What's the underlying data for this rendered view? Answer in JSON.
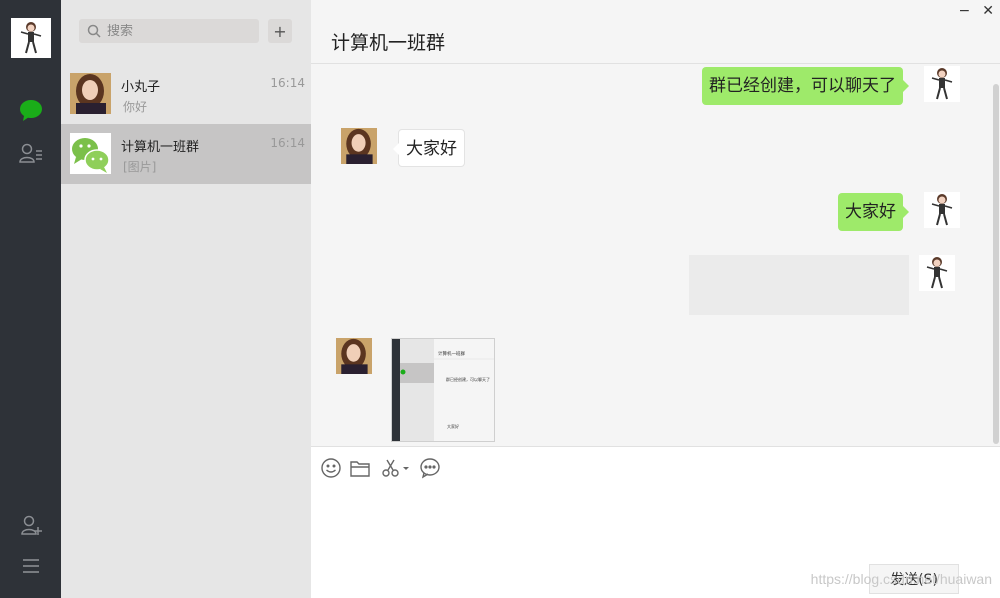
{
  "sidebar": {
    "icons": [
      "user-avatar",
      "chat-icon",
      "contacts-icon",
      "add-contact-icon",
      "menu-icon"
    ],
    "accent": "#1aad19"
  },
  "search": {
    "placeholder": "搜索",
    "add_label": "+"
  },
  "conversations": [
    {
      "name": "小丸子",
      "time": "16:14",
      "preview": "你好"
    },
    {
      "name": "计算机一班群",
      "time": "16:14",
      "preview": "[图片]"
    }
  ],
  "window": {
    "minimize": "−",
    "close": "✕"
  },
  "chat": {
    "title": "计算机一班群",
    "messages": [
      {
        "side": "right",
        "text": "群已经创建，可以聊天了"
      },
      {
        "side": "left",
        "text": "大家好"
      },
      {
        "side": "right",
        "text": "大家好"
      }
    ]
  },
  "thumbnail": {
    "title": "计算机一班群",
    "bubble1": "群已经创建，可以聊天了",
    "bubble2": "大家好"
  },
  "input": {
    "send_label": "发送(S)"
  },
  "watermark": "https://blog.csdn.net/huaiwan",
  "colors": {
    "bubble_green": "#9eea6a",
    "sidebar_dark": "#2e3238",
    "list_bg": "#e6e6e6",
    "active_item": "#c6c5c5"
  }
}
